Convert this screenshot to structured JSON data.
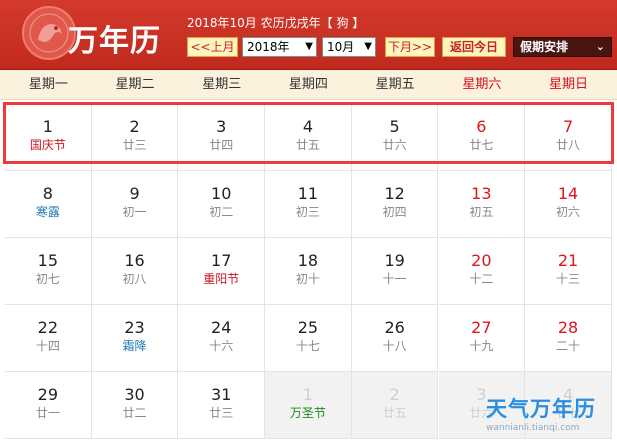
{
  "header": {
    "app_title": "万年历",
    "info_text": "2018年10月 农历戊戌年【 狗 】",
    "prev_month": "<<上月",
    "year_value": "2018年",
    "month_value": "10月",
    "next_month": "下月>>",
    "today_button": "返回今日",
    "holiday_button": "假期安排",
    "arrow_down": "▼",
    "chevron": "⌄"
  },
  "weekdays": [
    "星期一",
    "星期二",
    "星期三",
    "星期四",
    "星期五",
    "星期六",
    "星期日"
  ],
  "weeks": [
    [
      {
        "day": "1",
        "sub": "国庆节",
        "type": "holiday"
      },
      {
        "day": "2",
        "sub": "廿三",
        "type": "lunar"
      },
      {
        "day": "3",
        "sub": "廿四",
        "type": "lunar"
      },
      {
        "day": "4",
        "sub": "廿五",
        "type": "lunar"
      },
      {
        "day": "5",
        "sub": "廿六",
        "type": "lunar"
      },
      {
        "day": "6",
        "sub": "廿七",
        "type": "lunar"
      },
      {
        "day": "7",
        "sub": "廿八",
        "type": "lunar"
      }
    ],
    [
      {
        "day": "8",
        "sub": "寒露",
        "type": "term"
      },
      {
        "day": "9",
        "sub": "初一",
        "type": "lunar"
      },
      {
        "day": "10",
        "sub": "初二",
        "type": "lunar"
      },
      {
        "day": "11",
        "sub": "初三",
        "type": "lunar"
      },
      {
        "day": "12",
        "sub": "初四",
        "type": "lunar"
      },
      {
        "day": "13",
        "sub": "初五",
        "type": "lunar"
      },
      {
        "day": "14",
        "sub": "初六",
        "type": "lunar"
      }
    ],
    [
      {
        "day": "15",
        "sub": "初七",
        "type": "lunar"
      },
      {
        "day": "16",
        "sub": "初八",
        "type": "lunar"
      },
      {
        "day": "17",
        "sub": "重阳节",
        "type": "holiday"
      },
      {
        "day": "18",
        "sub": "初十",
        "type": "lunar"
      },
      {
        "day": "19",
        "sub": "十一",
        "type": "lunar"
      },
      {
        "day": "20",
        "sub": "十二",
        "type": "lunar"
      },
      {
        "day": "21",
        "sub": "十三",
        "type": "lunar"
      }
    ],
    [
      {
        "day": "22",
        "sub": "十四",
        "type": "lunar"
      },
      {
        "day": "23",
        "sub": "霜降",
        "type": "term"
      },
      {
        "day": "24",
        "sub": "十六",
        "type": "lunar"
      },
      {
        "day": "25",
        "sub": "十七",
        "type": "lunar"
      },
      {
        "day": "26",
        "sub": "十八",
        "type": "lunar"
      },
      {
        "day": "27",
        "sub": "十九",
        "type": "lunar"
      },
      {
        "day": "28",
        "sub": "二十",
        "type": "lunar"
      }
    ],
    [
      {
        "day": "29",
        "sub": "廿一",
        "type": "lunar"
      },
      {
        "day": "30",
        "sub": "廿二",
        "type": "lunar"
      },
      {
        "day": "31",
        "sub": "廿三",
        "type": "lunar"
      },
      {
        "day": "1",
        "sub": "万圣节",
        "type": "foreign",
        "other": true
      },
      {
        "day": "2",
        "sub": "廿五",
        "type": "lunar",
        "other": true
      },
      {
        "day": "3",
        "sub": "廿六",
        "type": "lunar",
        "other": true
      },
      {
        "day": "4",
        "sub": "廿七",
        "type": "lunar",
        "other": true
      }
    ]
  ],
  "watermark": {
    "title": "天气万年历",
    "url": "wannianli.tianqi.com"
  },
  "colors": {
    "header_red": "#c0291d",
    "weekend_red": "#e0141e",
    "highlight_border": "#ee3a3a",
    "term_blue": "#1c7ab3",
    "foreign_green": "#1d8a1d"
  }
}
